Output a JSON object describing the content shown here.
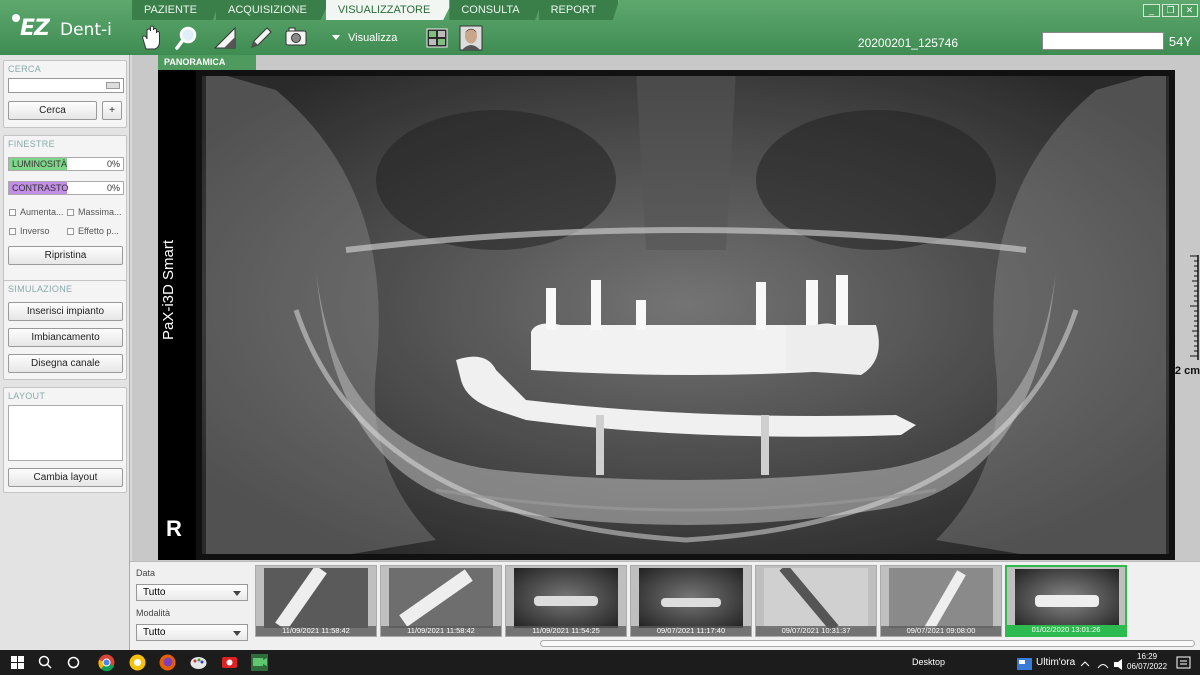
{
  "app": {
    "logo_ez": "EZ",
    "logo_dent": "Dent-i"
  },
  "tabs": [
    {
      "label": "PAZIENTE",
      "active": false
    },
    {
      "label": "ACQUISIZIONE",
      "active": false
    },
    {
      "label": "VISUALIZZATORE",
      "active": true
    },
    {
      "label": "CONSULTA",
      "active": false
    },
    {
      "label": "REPORT",
      "active": false
    }
  ],
  "toolbar": {
    "tools": [
      "hand-icon",
      "magnifier-icon",
      "ruler-angle-icon",
      "pencil-icon",
      "camera-capture-icon"
    ],
    "visualizza_label": "Visualizza",
    "extra_tools": [
      "layout-grid-icon",
      "patient-face-icon"
    ]
  },
  "patient": {
    "id": "20200201_125746",
    "age": "54Y"
  },
  "sidebar": {
    "cerca": {
      "title": "CERCA",
      "search_value": "",
      "search_button": "Cerca",
      "add_button": "+"
    },
    "finestre": {
      "title": "FINESTRE",
      "luminosita": {
        "label": "LUMINOSITÀ",
        "value": "0%",
        "color": "#7fd68a"
      },
      "contrasto": {
        "label": "CONTRASTO",
        "value": "0%",
        "color": "#c28ee6"
      },
      "checkboxes": [
        "Aumenta...",
        "Massima...",
        "Inverso",
        "Effetto p..."
      ],
      "reset_button": "Ripristina"
    },
    "simulazione": {
      "title": "SIMULAZIONE",
      "buttons": [
        "Inserisci impianto",
        "Imbiancamento",
        "Disegna canale"
      ]
    },
    "layout": {
      "title": "LAYOUT",
      "button": "Cambia layout"
    }
  },
  "viewer": {
    "tab_label": "PANORAMICA",
    "device": "PaX-i3D Smart",
    "side": "R",
    "scale_label": "2 cm"
  },
  "filters": {
    "data_label": "Data",
    "data_value": "Tutto",
    "modalita_label": "Modalità",
    "modalita_value": "Tutto"
  },
  "thumbnails": [
    {
      "timestamp": "11/09/2021 11:58:42",
      "kind": "intraoral",
      "selected": false
    },
    {
      "timestamp": "11/09/2021 11:58:42",
      "kind": "intraoral",
      "selected": false
    },
    {
      "timestamp": "11/09/2021 11:54:25",
      "kind": "panoramic",
      "selected": false
    },
    {
      "timestamp": "09/07/2021 11:17:40",
      "kind": "panoramic",
      "selected": false
    },
    {
      "timestamp": "09/07/2021 10:31:37",
      "kind": "intraoral",
      "selected": false
    },
    {
      "timestamp": "09/07/2021 09:08:00",
      "kind": "intraoral",
      "selected": false
    },
    {
      "timestamp": "01/02/2020 13:01:26",
      "kind": "panoramic",
      "selected": true
    }
  ],
  "taskbar": {
    "desktop_label": "Desktop",
    "news_label": "Ultim'ora",
    "time": "16:29",
    "date": "06/07/2022"
  },
  "colors": {
    "header_green": "#4f9a5e",
    "selected_green": "#2dbb4f"
  }
}
